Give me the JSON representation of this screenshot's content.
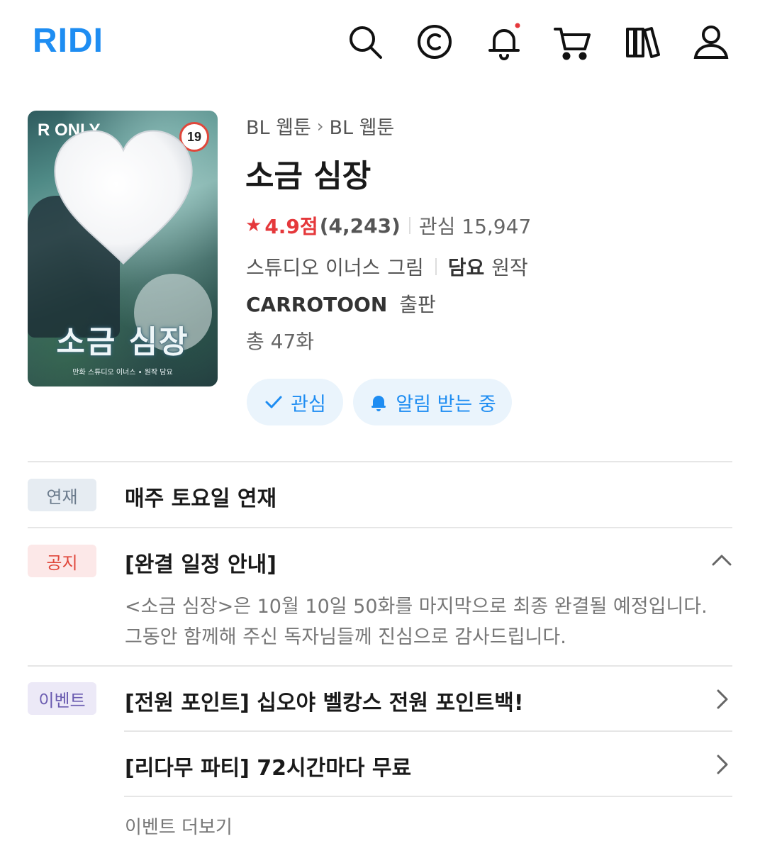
{
  "header": {
    "logo": "RIDI",
    "icons": [
      "search-icon",
      "cash-icon",
      "bell-icon",
      "cart-icon",
      "library-icon",
      "user-icon"
    ],
    "bell_has_notification": true,
    "accent_color": "#1e8df2"
  },
  "cover": {
    "brand": "R ONLY",
    "age_badge": "19",
    "title_art": "소금 심장",
    "credit_line": "만화 스튜디오 이너스 • 원작 담요",
    "overlay": "white-heart-icon"
  },
  "book": {
    "breadcrumb": [
      "BL 웹툰",
      "BL 웹툰"
    ],
    "title": "소금 심장",
    "rating_score": "4.9점",
    "rating_count": "(4,243)",
    "favorites": "관심 15,947",
    "artist_name": "스튜디오 이너스",
    "artist_role": "그림",
    "author_name": "담요",
    "author_role": "원작",
    "publisher_name": "CARROTOON",
    "publisher_role": "출판",
    "episodes": "총 47화"
  },
  "actions": {
    "favorite_label": "관심",
    "notify_label": "알림 받는 중"
  },
  "serial": {
    "badge": "연재",
    "text": "매주 토요일 연재"
  },
  "notice": {
    "badge": "공지",
    "title": "[완결 일정 안내]",
    "body": "<소금 심장>은 10월 10일 50화를 마지막으로 최종 완결될 예정입니다. 그동안 함께해 주신 독자님들께 진심으로 감사드립니다.",
    "expanded": true
  },
  "events": {
    "badge": "이벤트",
    "items": [
      {
        "label": "[전원 포인트] 십오야 벨캉스 전원 포인트백!"
      },
      {
        "label": "[리다무 파티] 72시간마다 무료"
      }
    ],
    "more_label": "이벤트 더보기"
  }
}
